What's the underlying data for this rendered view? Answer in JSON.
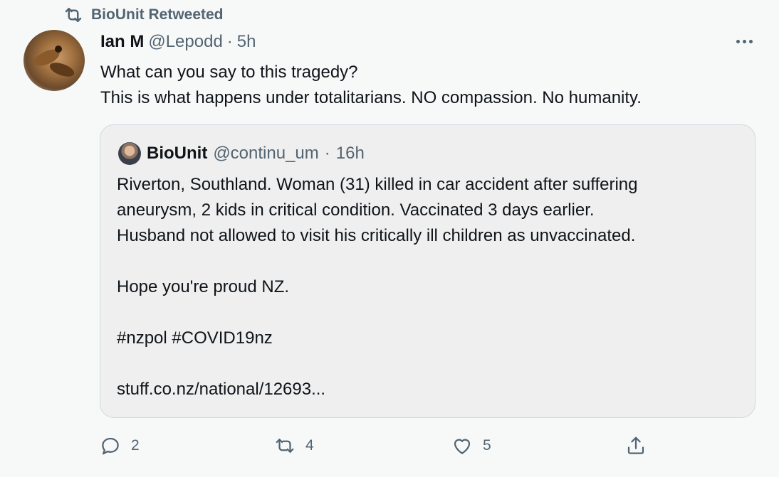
{
  "retweet_bar": {
    "label": "BioUnit Retweeted",
    "icon": "retweet-icon"
  },
  "tweet": {
    "author_name": "Ian M",
    "handle": "@Lepodd",
    "separator": "·",
    "time": "5h",
    "text": "What can you say to this tragedy?\nThis is what happens under totalitarians. NO compassion. No humanity."
  },
  "quote": {
    "author_name": "BioUnit",
    "handle": "@continu_um",
    "separator": "·",
    "time": "16h",
    "text": "Riverton, Southland. Woman (31) killed in car accident after suffering\naneurysm, 2 kids in critical condition. Vaccinated 3 days earlier.\nHusband not allowed to visit his critically ill children as unvaccinated.\n\nHope you're proud NZ.\n\n#nzpol #COVID19nz\n\nstuff.co.nz/national/12693..."
  },
  "actions": {
    "reply_count": "2",
    "retweet_count": "4",
    "like_count": "5"
  },
  "colors": {
    "muted": "#536471",
    "text": "#0f1419",
    "background": "#f7f9f9",
    "card_bg": "#efefef",
    "card_border": "#cfd9de"
  }
}
